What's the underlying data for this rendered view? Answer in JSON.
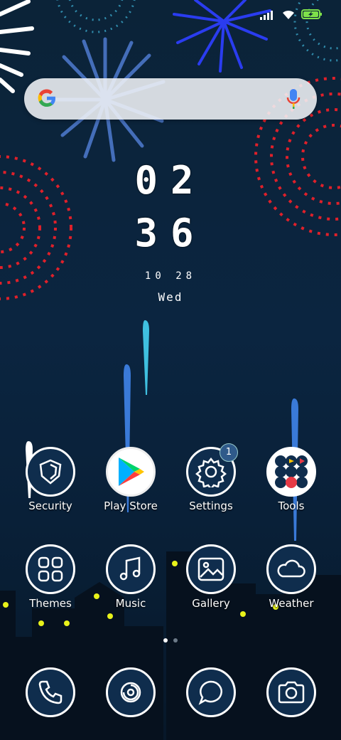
{
  "status_bar": {
    "icons": [
      "signal-icon",
      "wifi-icon",
      "battery-charging-icon"
    ]
  },
  "search": {
    "icon": "google-logo-icon",
    "mic": "mic-icon"
  },
  "clock": {
    "hours": "02",
    "minutes": "36",
    "date": "10 28",
    "weekday": "Wed"
  },
  "apps_row1": [
    {
      "label": "Security",
      "icon": "shield-icon"
    },
    {
      "label": "Play Store",
      "icon": "play-store-icon"
    },
    {
      "label": "Settings",
      "icon": "gear-icon",
      "badge": "1"
    },
    {
      "label": "Tools",
      "icon": "folder-grid-icon"
    }
  ],
  "apps_row2": [
    {
      "label": "Themes",
      "icon": "themes-icon"
    },
    {
      "label": "Music",
      "icon": "music-note-icon"
    },
    {
      "label": "Gallery",
      "icon": "gallery-icon"
    },
    {
      "label": "Weather",
      "icon": "cloud-icon"
    }
  ],
  "dock": [
    {
      "icon": "phone-icon"
    },
    {
      "icon": "contacts-icon"
    },
    {
      "icon": "messages-icon"
    },
    {
      "icon": "camera-icon"
    }
  ],
  "page_indicator": {
    "pages": 2,
    "current": 1
  },
  "colors": {
    "background": "#0b2338",
    "accent_red": "#e0202a",
    "accent_blue": "#2f6fd6",
    "icon_fill": "#0f2d4d"
  }
}
